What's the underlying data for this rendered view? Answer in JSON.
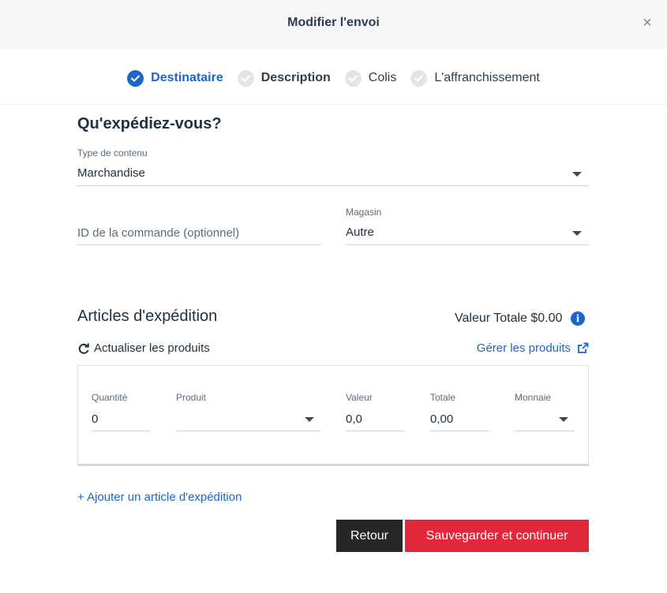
{
  "modal": {
    "title": "Modifier l'envoi",
    "close_glyph": "×"
  },
  "stepper": {
    "steps": [
      {
        "label": "Destinataire",
        "state": "completed-active"
      },
      {
        "label": "Description",
        "state": "current"
      },
      {
        "label": "Colis",
        "state": "pending"
      },
      {
        "label": "L'affranchissement",
        "state": "pending"
      }
    ]
  },
  "section": {
    "title": "Qu'expédiez-vous?"
  },
  "content_type": {
    "label": "Type de contenu",
    "value": "Marchandise"
  },
  "order_id": {
    "placeholder": "ID de la commande (optionnel)",
    "value": ""
  },
  "store": {
    "label": "Magasin",
    "value": "Autre"
  },
  "articles": {
    "title": "Articles d'expédition",
    "total_label": "Valeur Totale $0.00",
    "info_glyph": "i",
    "refresh_label": "Actualiser les produits",
    "manage_label": "Gérer les produits",
    "columns": {
      "quantity": {
        "label": "Quantité",
        "value": "0"
      },
      "product": {
        "label": "Produit",
        "value": ""
      },
      "value": {
        "label": "Valeur",
        "value": "0,0"
      },
      "total": {
        "label": "Totale",
        "value": "0,00"
      },
      "currency": {
        "label": "Monnaie",
        "value": ""
      }
    },
    "add_label": "+ Ajouter un article d'expédition"
  },
  "buttons": {
    "back": "Retour",
    "save": "Sauvegarder et continuer"
  },
  "colors": {
    "accent": "#1a66c9",
    "danger": "#e0283a",
    "dark_button": "#252729"
  },
  "icons": [
    "close-icon",
    "check-icon",
    "info-icon",
    "refresh-icon",
    "external-link-icon",
    "caret-down-icon"
  ]
}
